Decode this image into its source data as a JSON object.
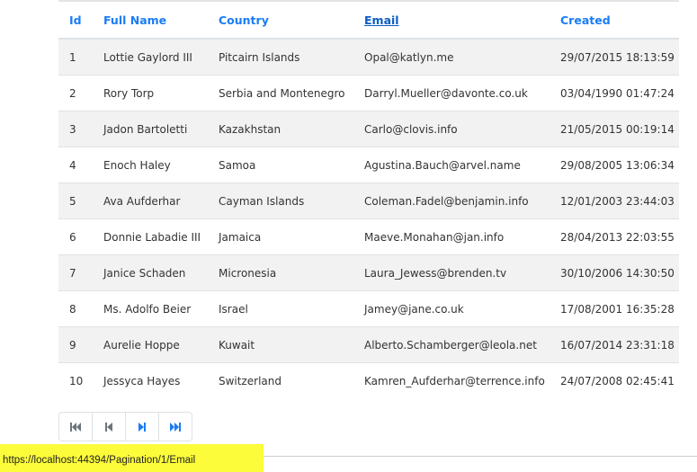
{
  "columns": [
    "Id",
    "Full Name",
    "Country",
    "Email",
    "Created"
  ],
  "sorted_column": "Email",
  "rows": [
    [
      "1",
      "Lottie Gaylord III",
      "Pitcairn Islands",
      "Opal@katlyn.me",
      "29/07/2015 18:13:59"
    ],
    [
      "2",
      "Rory Torp",
      "Serbia and Montenegro",
      "Darryl.Mueller@davonte.co.uk",
      "03/04/1990 01:47:24"
    ],
    [
      "3",
      "Jadon Bartoletti",
      "Kazakhstan",
      "Carlo@clovis.info",
      "21/05/2015 00:19:14"
    ],
    [
      "4",
      "Enoch Haley",
      "Samoa",
      "Agustina.Bauch@arvel.name",
      "29/08/2005 13:06:34"
    ],
    [
      "5",
      "Ava Aufderhar",
      "Cayman Islands",
      "Coleman.Fadel@benjamin.info",
      "12/01/2003 23:44:03"
    ],
    [
      "6",
      "Donnie Labadie III",
      "Jamaica",
      "Maeve.Monahan@jan.info",
      "28/04/2013 22:03:55"
    ],
    [
      "7",
      "Janice Schaden",
      "Micronesia",
      "Laura_Jewess@brenden.tv",
      "30/10/2006 14:30:50"
    ],
    [
      "8",
      "Ms. Adolfo Beier",
      "Israel",
      "Jamey@jane.co.uk",
      "17/08/2001 16:35:28"
    ],
    [
      "9",
      "Aurelie Hoppe",
      "Kuwait",
      "Alberto.Schamberger@leola.net",
      "16/07/2014 23:31:18"
    ],
    [
      "10",
      "Jessyca Hayes",
      "Switzerland",
      "Kamren_Aufderhar@terrence.info",
      "24/07/2008 02:45:41"
    ]
  ],
  "pagination": [
    {
      "icon": "first-page-icon",
      "enabled": false,
      "color": "#6c757d"
    },
    {
      "icon": "previous-page-icon",
      "enabled": false,
      "color": "#6c757d"
    },
    {
      "icon": "next-page-icon",
      "enabled": true,
      "color": "#1a7cf5"
    },
    {
      "icon": "last-page-icon",
      "enabled": true,
      "color": "#1a7cf5"
    }
  ],
  "status_bar": {
    "url": "https://localhost:44394/Pagination/1/Email",
    "highlight": "#fcfc3a"
  }
}
